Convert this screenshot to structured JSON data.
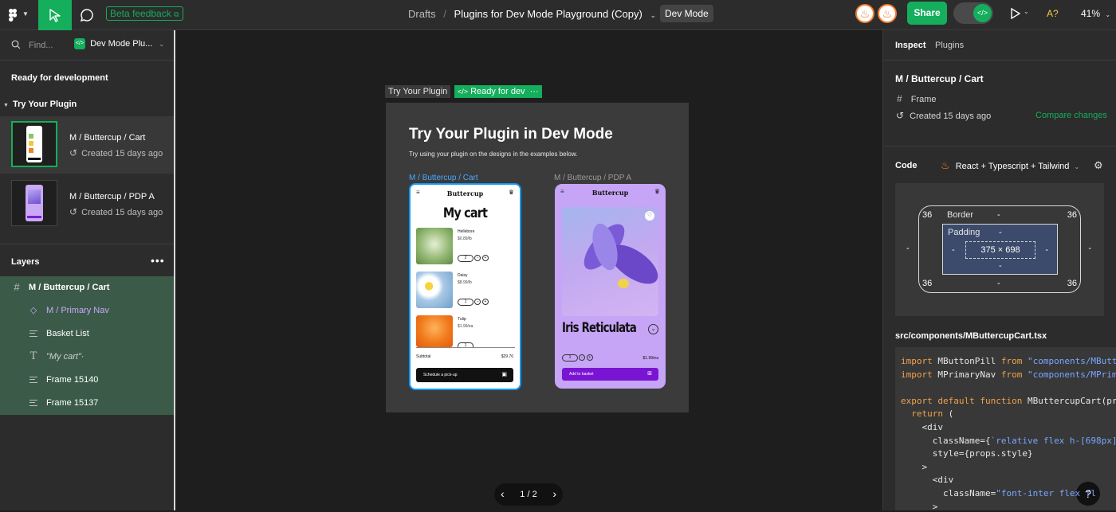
{
  "topbar": {
    "beta_label": "Beta feedback",
    "breadcrumb_parent": "Drafts",
    "breadcrumb_sep": "/",
    "file_title": "Plugins for Dev Mode Playground (Copy)",
    "mode_badge": "Dev Mode",
    "share_label": "Share",
    "font_warning": "A?",
    "zoom": "41%"
  },
  "left": {
    "search_placeholder": "Find...",
    "page_selector": "Dev Mode Plu...",
    "section_ready": "Ready for development",
    "section_try": "Try Your Plugin",
    "frames": [
      {
        "title": "M / Buttercup / Cart",
        "meta": "Created 15 days ago"
      },
      {
        "title": "M / Buttercup / PDP A",
        "meta": "Created 15 days ago"
      }
    ],
    "layers_title": "Layers",
    "layers": [
      {
        "label": "M / Buttercup / Cart",
        "icon": "frame-icon"
      },
      {
        "label": "M / Primary Nav",
        "icon": "component-icon"
      },
      {
        "label": "Basket List",
        "icon": "auto-layout-icon"
      },
      {
        "label": "\"My cart\"·",
        "icon": "text-icon"
      },
      {
        "label": "Frame 15140",
        "icon": "auto-layout-icon"
      },
      {
        "label": "Frame 15137",
        "icon": "auto-layout-icon"
      }
    ]
  },
  "canvas": {
    "section_label": "Try Your Plugin",
    "ready_label": "Ready for dev",
    "board_title": "Try Your Plugin in Dev Mode",
    "board_subtitle": "Try using your plugin on the designs in the examples below.",
    "cart_frame_label": "M / Buttercup / Cart",
    "pdp_frame_label": "M / Buttercup / PDP A",
    "brand": "Buttercup",
    "cart_heading": "My cart",
    "items": [
      {
        "name": "Hellebore",
        "price": "$0.89/lb",
        "qty": "2"
      },
      {
        "name": "Daisy",
        "price": "$8.99/lb",
        "qty": "1"
      },
      {
        "name": "Tulip",
        "price": "$1.99/ea",
        "qty": "1"
      }
    ],
    "subtotal_label": "Subtotal",
    "subtotal_value": "$29.76",
    "pickup_label": "Schedule a pick-up",
    "pdp_title": "Iris Reticulata",
    "pdp_qty": "1",
    "pdp_price": "$1.99/ea",
    "add_label": "Add to basket",
    "pager": "1 / 2"
  },
  "right": {
    "tab_inspect": "Inspect",
    "tab_plugins": "Plugins",
    "selection_title": "M / Buttercup / Cart",
    "type_label": "Frame",
    "created": "Created 15 days ago",
    "compare": "Compare changes",
    "code_label": "Code",
    "code_lang": "React + Typescript + Tailwind",
    "box": {
      "border_label": "Border",
      "padding_label": "Padding",
      "corner": "36",
      "dash": "-",
      "size": "375 × 698"
    },
    "file_path": "src/components/MButtercupCart.tsx",
    "code": [
      {
        "kw": "import",
        "txt": " MButtonPill ",
        "kw2": "from",
        "str": " \"components/MButto"
      },
      {
        "kw": "import",
        "txt": " MPrimaryNav ",
        "kw2": "from",
        "str": " \"components/MPrima"
      },
      {
        "kw": "",
        "txt": "",
        "kw2": "",
        "str": ""
      },
      {
        "kw": "export default function",
        "txt": " MButtercupCart(prop",
        "kw2": "",
        "str": ""
      },
      {
        "kw": "  return",
        "txt": " (",
        "kw2": "",
        "str": ""
      },
      {
        "kw": "",
        "txt": "    <div",
        "kw2": "",
        "str": ""
      },
      {
        "kw": "",
        "txt": "      className={",
        "kw2": "",
        "str": "`relative flex h-[698px]"
      },
      {
        "kw": "",
        "txt": "      style={props.style}",
        "kw2": "",
        "str": ""
      },
      {
        "kw": "",
        "txt": "    >",
        "kw2": "",
        "str": ""
      },
      {
        "kw": "",
        "txt": "      <div",
        "kw2": "",
        "str": ""
      },
      {
        "kw": "",
        "txt": "        className=",
        "kw2": "",
        "str": "\"font-inter flex fl"
      },
      {
        "kw": "",
        "txt": "      >",
        "kw2": "",
        "str": ""
      }
    ],
    "help": "?"
  },
  "colors": {
    "accent_green": "#14ae5c",
    "selection_blue": "#0d99ff",
    "layer_highlight": "#3b5b48",
    "component_purple": "#c7a7ff"
  }
}
